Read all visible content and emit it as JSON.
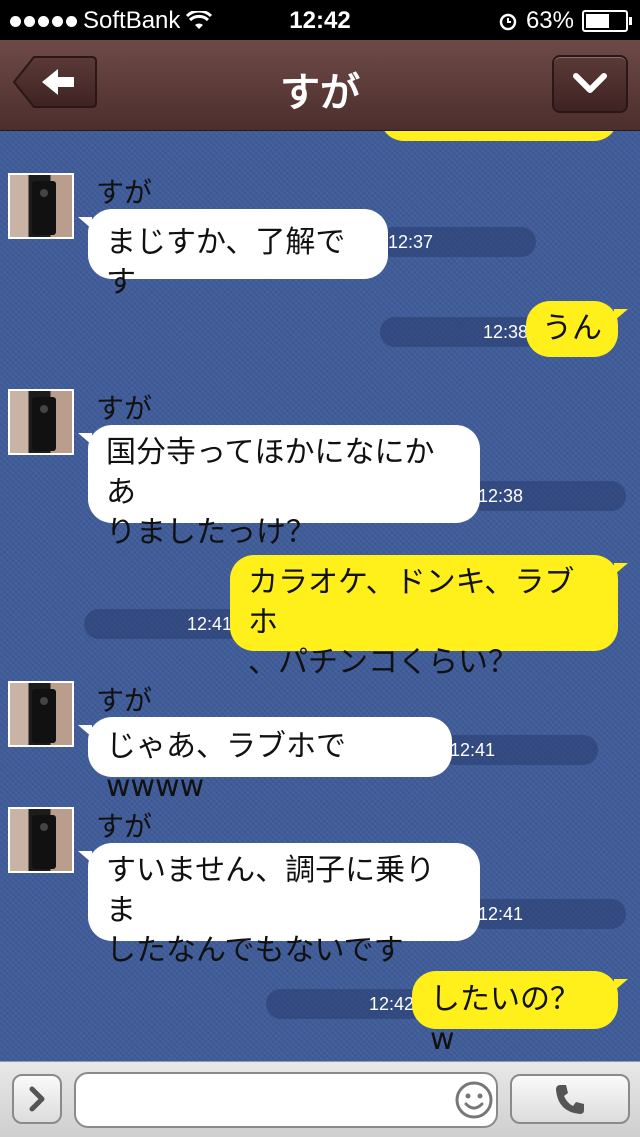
{
  "status_bar": {
    "carrier": "SoftBank",
    "time": "12:42",
    "battery": "63%",
    "battery_level": 0.63
  },
  "header": {
    "title": "すが"
  },
  "messages": [
    {
      "name": "すが",
      "text": "まじすか、了解です",
      "time": "12:37"
    },
    {
      "text": "うん",
      "time": "12:38"
    },
    {
      "name": "すが",
      "line1": "国分寺ってほかになにかあ",
      "line2": "りましたっけ？",
      "time": "12:38"
    },
    {
      "line1": "カラオケ、ドンキ、ラブホ",
      "line2": "、パチンコくらい？",
      "time": "12:41"
    },
    {
      "name": "すが",
      "text": "じゃあ、ラブホでwwww",
      "time": "12:41"
    },
    {
      "name": "すが",
      "line1": "すいません、調子に乗りま",
      "line2": "したなんでもないです",
      "time": "12:41"
    },
    {
      "text": "したいの？w",
      "time": "12:42"
    }
  ],
  "input": {
    "value": "",
    "placeholder": ""
  },
  "icons": {
    "back": "back-arrow-icon",
    "menu": "chevron-down-icon",
    "attach": "chevron-right-icon",
    "emoji": "smiley-icon",
    "call": "phone-icon"
  }
}
